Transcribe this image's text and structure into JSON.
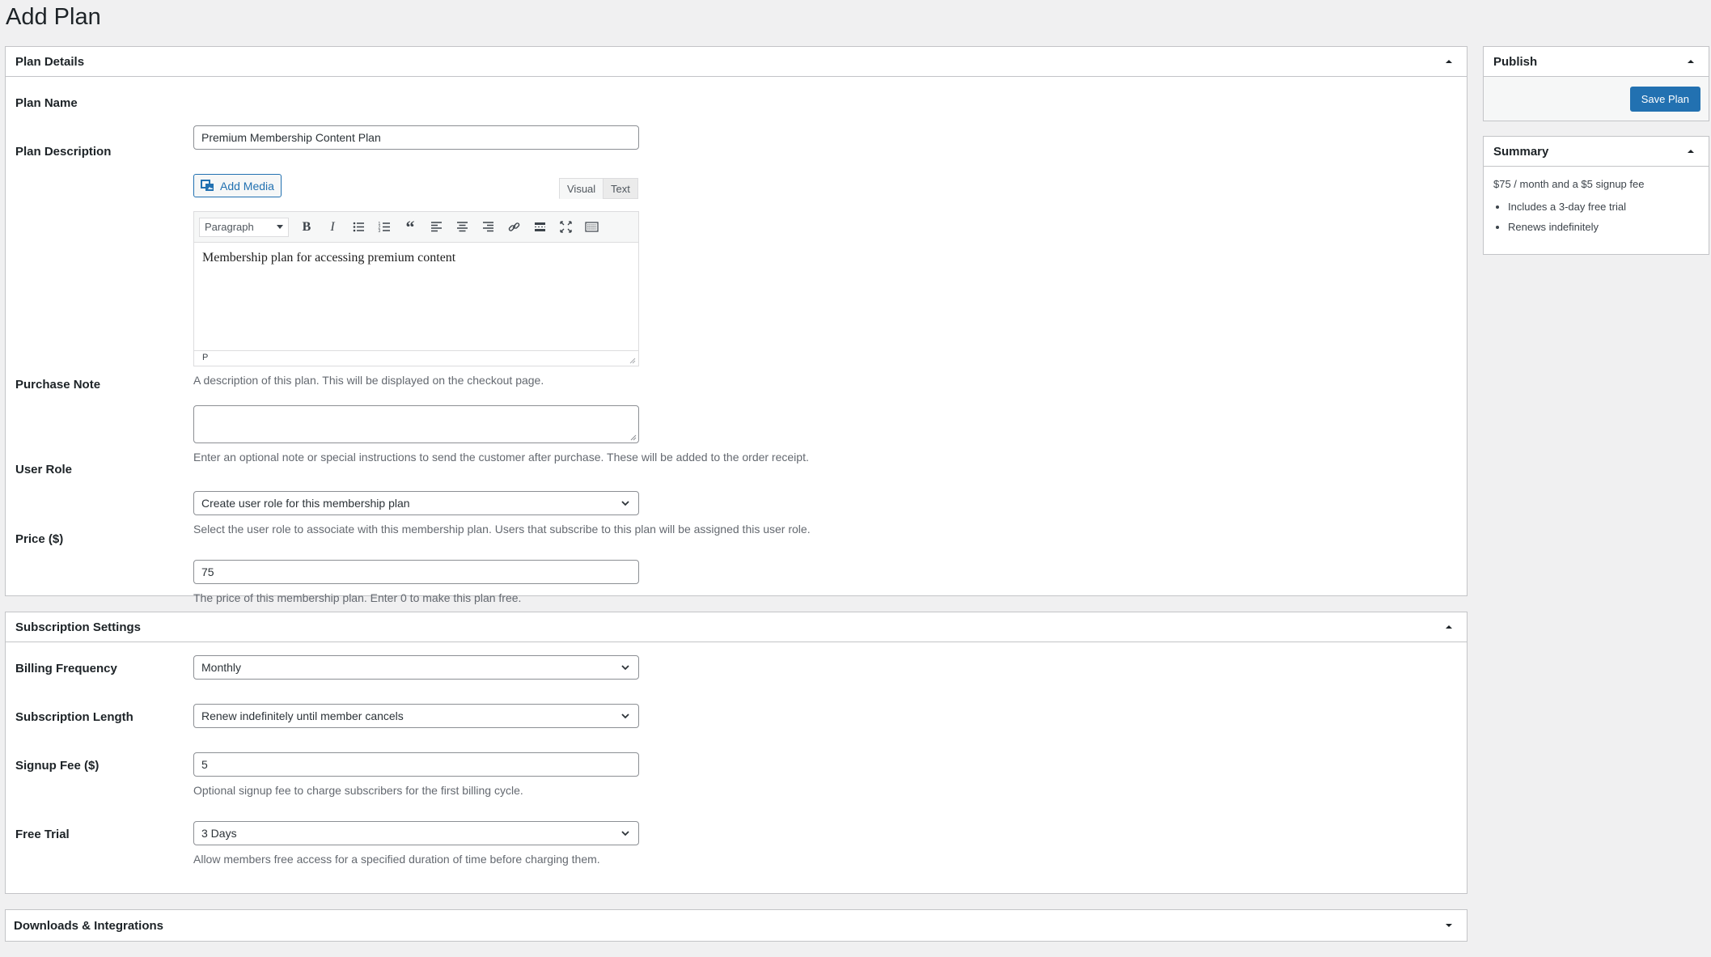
{
  "page": {
    "title": "Add Plan"
  },
  "plan_details": {
    "title": "Plan Details",
    "plan_name": {
      "label": "Plan Name",
      "value": "Premium Membership Content Plan"
    },
    "plan_description": {
      "label": "Plan Description",
      "add_media": "Add Media",
      "tab_visual": "Visual",
      "tab_text": "Text",
      "format_select": "Paragraph",
      "content": "Membership plan for accessing premium content",
      "status_path": "P",
      "help": "A description of this plan. This will be displayed on the checkout page."
    },
    "purchase_note": {
      "label": "Purchase Note",
      "value": "",
      "help": "Enter an optional note or special instructions to send the customer after purchase. These will be added to the order receipt."
    },
    "user_role": {
      "label": "User Role",
      "value": "Create user role for this membership plan",
      "help": "Select the user role to associate with this membership plan. Users that subscribe to this plan will be assigned this user role."
    },
    "price": {
      "label": "Price ($)",
      "value": "75",
      "help": "The price of this membership plan. Enter 0 to make this plan free."
    }
  },
  "subscription": {
    "title": "Subscription Settings",
    "billing_frequency": {
      "label": "Billing Frequency",
      "value": "Monthly"
    },
    "subscription_length": {
      "label": "Subscription Length",
      "value": "Renew indefinitely until member cancels"
    },
    "signup_fee": {
      "label": "Signup Fee ($)",
      "value": "5",
      "help": "Optional signup fee to charge subscribers for the first billing cycle."
    },
    "free_trial": {
      "label": "Free Trial",
      "value": "3 Days",
      "help": "Allow members free access for a specified duration of time before charging them."
    }
  },
  "downloads": {
    "title": "Downloads & Integrations"
  },
  "publish": {
    "title": "Publish",
    "save_label": "Save Plan"
  },
  "summary": {
    "title": "Summary",
    "line": "$75 / month and a $5 signup fee",
    "items": [
      "Includes a 3-day free trial",
      "Renews indefinitely"
    ]
  },
  "colors": {
    "accent": "#2271b1",
    "border": "#c3c4c7",
    "background": "#f0f0f1"
  }
}
